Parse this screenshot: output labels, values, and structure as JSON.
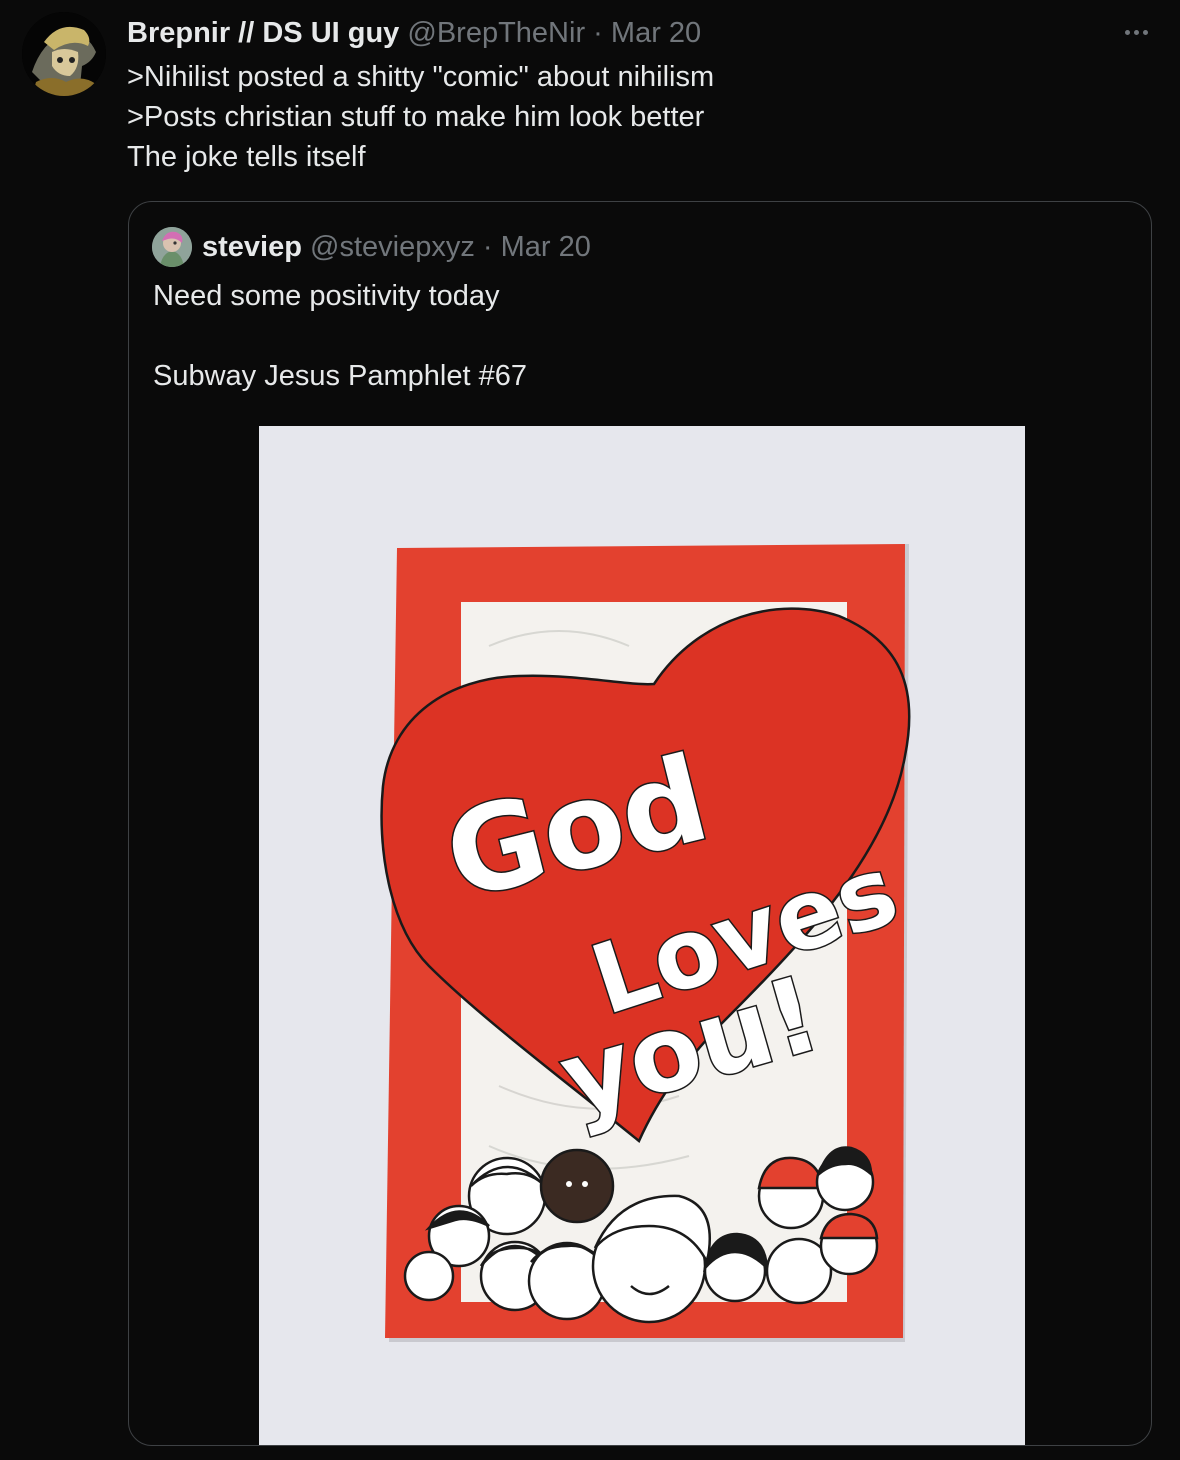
{
  "tweet": {
    "author_name": "Brepnir // DS UI guy",
    "author_handle": "@BrepTheNir",
    "separator": "·",
    "date": "Mar 20",
    "lines": [
      ">Nihilist posted a shitty \"comic\" about nihilism",
      ">Posts christian stuff to make him look better",
      "The joke tells itself"
    ]
  },
  "quote": {
    "author_name": "steviep",
    "author_handle": "@steviepxyz",
    "separator": "·",
    "date": "Mar 20",
    "line1": "Need some positivity today",
    "line2": "Subway Jesus Pamphlet #67"
  },
  "pamphlet": {
    "word1": "God",
    "word2": "Loves",
    "word3": "you!"
  },
  "colors": {
    "background": "#0a0a0a",
    "text": "#e7e9ea",
    "muted": "#71767b",
    "border": "#3e4144",
    "pamphlet_red": "#e3412f"
  },
  "icons": {
    "more": "more-options-icon"
  }
}
